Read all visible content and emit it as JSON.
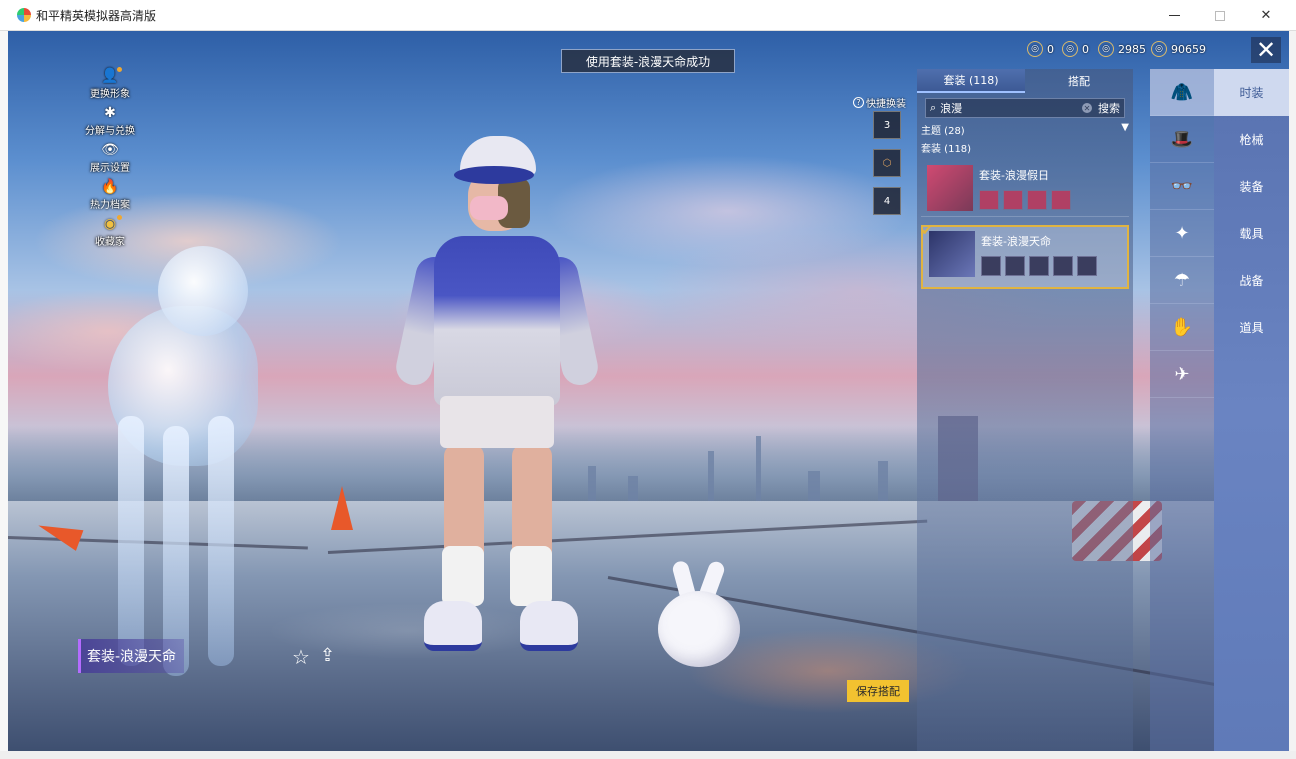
{
  "window": {
    "title": "和平精英模拟器高清版",
    "minimize_icon": "minimize-icon",
    "maximize_icon": "maximize-icon",
    "close_glyph": "✕"
  },
  "toast": "使用套装-浪漫天命成功",
  "left_menu": [
    {
      "label": "更换形象",
      "icon": "person-icon",
      "glyph": "👤"
    },
    {
      "label": "分解与兑换",
      "icon": "puzzle-icon",
      "glyph": "✱"
    },
    {
      "label": "展示设置",
      "icon": "eye-icon",
      "glyph": "👁"
    },
    {
      "label": "热力档案",
      "icon": "flame-icon",
      "glyph": "🔥"
    },
    {
      "label": "收藏家",
      "icon": "collector-badge-icon",
      "glyph": "◉"
    }
  ],
  "currency": [
    {
      "value": "0",
      "icon": "coin-a-icon"
    },
    {
      "value": "0",
      "icon": "coin-b-icon"
    },
    {
      "value": "2985",
      "icon": "coin-c-icon"
    },
    {
      "value": "90659",
      "icon": "coin-d-icon"
    }
  ],
  "close_game_glyph": "✕",
  "quick_swap": {
    "label": "快捷换装",
    "help_glyph": "?",
    "slots": [
      "3",
      "",
      "4"
    ]
  },
  "panel": {
    "tabs": [
      "套装 (118)",
      "搭配"
    ],
    "active_tab": 0,
    "search_value": "浪漫",
    "search_icon_glyph": "⌕",
    "clear_glyph": "✕",
    "search_button": "搜索",
    "filter": "主题 (28)",
    "filter_arrow": "▼",
    "count": "套装 (118)",
    "outfits": [
      {
        "name": "套装-浪漫假日",
        "selected": false
      },
      {
        "name": "套装-浪漫天命",
        "selected": true
      }
    ],
    "check_glyph": "✔"
  },
  "category_icons": [
    "outfit-icon",
    "hat-icon",
    "glasses-icon",
    "weapon-skin-icon",
    "parachute-icon",
    "emote-icon",
    "vehicle-icon"
  ],
  "categories": [
    "时装",
    "枪械",
    "装备",
    "载具",
    "战备",
    "道具"
  ],
  "active_category": 0,
  "name_plate": "套装-浪漫天命",
  "fav_glyph": "☆",
  "share_glyph": "⇪",
  "save_button": "保存搭配"
}
